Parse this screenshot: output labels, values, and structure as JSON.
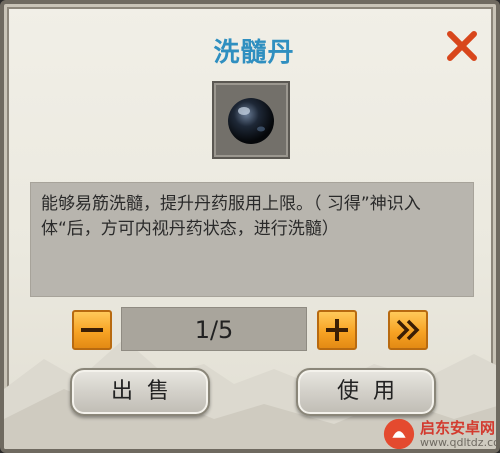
{
  "window": {
    "title": "洗髓丹"
  },
  "item": {
    "icon": "dark-pill-icon"
  },
  "description": "能够易筋洗髓，提升丹药服用上限。（ 习得”神识入体“后，方可内视丹药状态，进行洗髓）",
  "quantity": {
    "display": "1/5",
    "current": 1,
    "max": 5
  },
  "buttons": {
    "minus": "minus-icon",
    "plus": "plus-icon",
    "max": "double-chevron-right-icon",
    "sell": "出售",
    "use": "使用"
  },
  "watermark": {
    "line1": "启东安卓网",
    "line2": "www.qdltdz.com"
  },
  "colors": {
    "title": "#2f8fc0",
    "close": "#d8461c",
    "button_orange": "#f7a324"
  }
}
